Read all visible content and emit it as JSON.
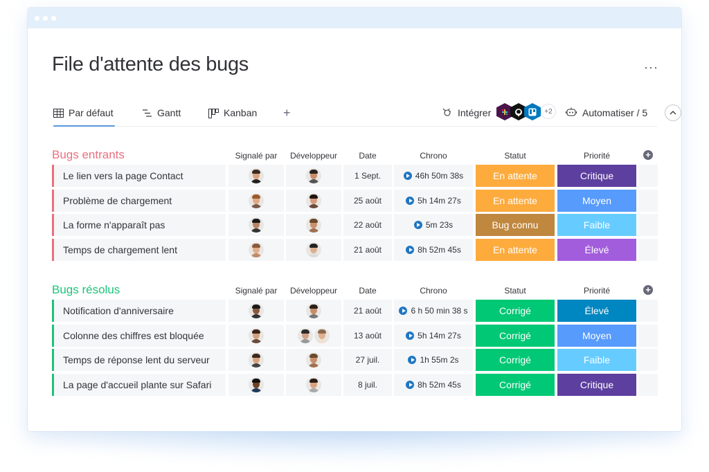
{
  "window": {
    "title": "File d'attente des bugs",
    "more_label": "···"
  },
  "views": {
    "tabs": [
      {
        "label": "Par défaut",
        "icon": "table-icon",
        "active": true
      },
      {
        "label": "Gantt",
        "icon": "gantt-icon",
        "active": false
      },
      {
        "label": "Kanban",
        "icon": "kanban-icon",
        "active": false
      }
    ],
    "add_label": "+",
    "integrate_label": "Intégrer",
    "apps": [
      "slack",
      "github",
      "trello"
    ],
    "apps_more": "+2",
    "automate_label": "Automatiser / 5"
  },
  "columns": {
    "reporter": "Signalé par",
    "developer": "Développeur",
    "date": "Date",
    "chrono": "Chrono",
    "status": "Statut",
    "priority": "Priorité"
  },
  "colors": {
    "incoming": "#e2445c",
    "resolved": "#00c875",
    "en_attente": "#fdab3d",
    "bug_connu": "#c0873f",
    "corrige": "#00c875",
    "critique": "#5c3f9e",
    "moyen": "#579bfc",
    "faible": "#66ccff",
    "eleve_incoming": "#a25ddc",
    "eleve_resolved": "#0086c0"
  },
  "groups": [
    {
      "title": "Bugs entrants",
      "color": "#e8707f",
      "rows": [
        {
          "name": "Le lien vers la page Contact",
          "date": "1 Sept.",
          "chrono": "46h 50m 38s",
          "status": "En attente",
          "status_color": "#fdab3d",
          "priority": "Critique",
          "priority_color": "#5c3f9e"
        },
        {
          "name": "Problème de chargement",
          "date": "25 août",
          "chrono": "5h 14m 27s",
          "status": "En attente",
          "status_color": "#fdab3d",
          "priority": "Moyen",
          "priority_color": "#579bfc"
        },
        {
          "name": "La forme n'apparaît pas",
          "date": "22 août",
          "chrono": "5m 23s",
          "status": "Bug connu",
          "status_color": "#c0873f",
          "priority": "Faible",
          "priority_color": "#66ccff"
        },
        {
          "name": "Temps de chargement lent",
          "date": "21 août",
          "chrono": "8h 52m 45s",
          "status": "En attente",
          "status_color": "#fdab3d",
          "priority": "Élevé",
          "priority_color": "#a25ddc"
        }
      ]
    },
    {
      "title": "Bugs résolus",
      "color": "#1cc47a",
      "rows": [
        {
          "name": "Notification d'anniversaire",
          "date": "21 août",
          "chrono": "6 h 50 min 38 s",
          "status": "Corrigé",
          "status_color": "#00c875",
          "priority": "Élevé",
          "priority_color": "#0086c0"
        },
        {
          "name": "Colonne des chiffres est bloquée",
          "date": "13 août",
          "chrono": "5h 14m 27s",
          "status": "Corrigé",
          "status_color": "#00c875",
          "priority": "Moyen",
          "priority_color": "#579bfc"
        },
        {
          "name": "Temps de réponse lent du serveur",
          "date": "27 juil.",
          "chrono": "1h 55m 2s",
          "status": "Corrigé",
          "status_color": "#00c875",
          "priority": "Faible",
          "priority_color": "#66ccff"
        },
        {
          "name": "La page d'accueil plante sur Safari",
          "date": "8 juil.",
          "chrono": "8h 52m 45s",
          "status": "Corrigé",
          "status_color": "#00c875",
          "priority": "Critique",
          "priority_color": "#5c3f9e"
        }
      ]
    }
  ]
}
